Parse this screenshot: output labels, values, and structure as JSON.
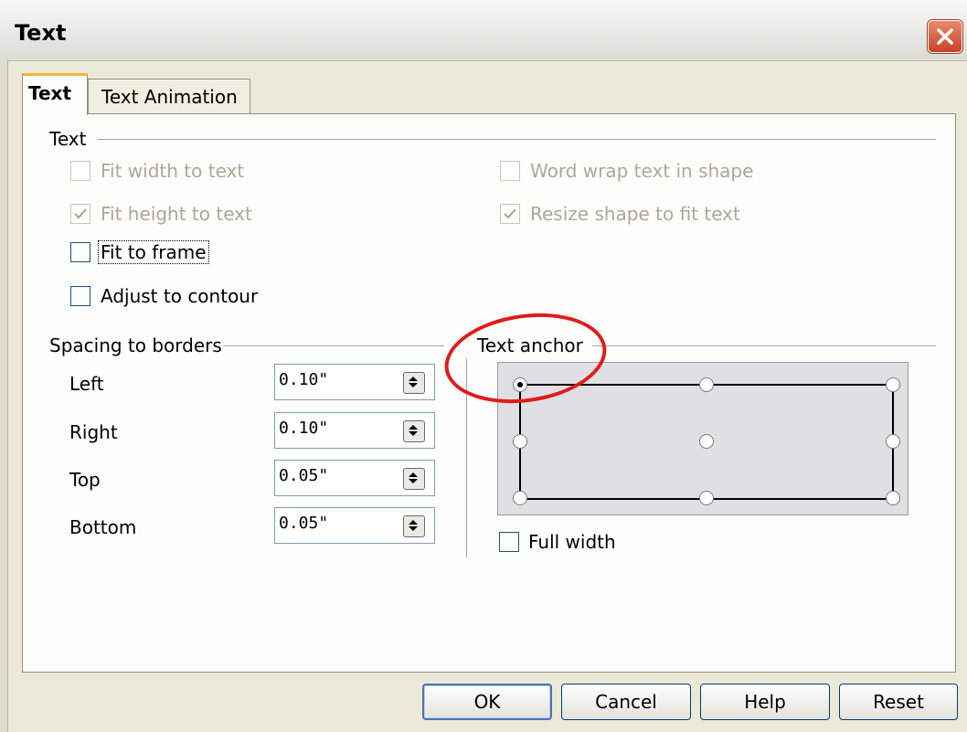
{
  "window": {
    "title": "Text"
  },
  "tabs": [
    {
      "label": "Text",
      "active": true
    },
    {
      "label": "Text Animation",
      "active": false
    }
  ],
  "text_group": {
    "label": "Text",
    "options": {
      "fit_width": {
        "label": "Fit width to text",
        "checked": false,
        "enabled": false
      },
      "fit_height": {
        "label": "Fit height to text",
        "checked": true,
        "enabled": false
      },
      "fit_frame": {
        "label": "Fit to frame",
        "checked": false,
        "enabled": true
      },
      "adjust_contour": {
        "label": "Adjust to contour",
        "checked": false,
        "enabled": true
      },
      "word_wrap": {
        "label": "Word wrap text in shape",
        "checked": false,
        "enabled": false
      },
      "resize_shape": {
        "label": "Resize shape to fit text",
        "checked": true,
        "enabled": false
      }
    }
  },
  "spacing": {
    "label": "Spacing to borders",
    "fields": [
      {
        "label": "Left",
        "value": "0.10\""
      },
      {
        "label": "Right",
        "value": "0.10\""
      },
      {
        "label": "Top",
        "value": "0.05\""
      },
      {
        "label": "Bottom",
        "value": "0.05\""
      }
    ]
  },
  "anchor": {
    "label": "Text anchor",
    "selected": "top-left",
    "full_width": {
      "label": "Full width",
      "checked": false
    }
  },
  "buttons": {
    "ok": "OK",
    "cancel": "Cancel",
    "help": "Help",
    "reset": "Reset"
  },
  "colors": {
    "highlight_ring": "#e01b1b",
    "dialog_bg": "#ece9d8",
    "close_button": "#c9412a"
  },
  "icons": {
    "close": "close-icon",
    "spin": "spin-updown-icon",
    "check": "checkmark-icon"
  }
}
